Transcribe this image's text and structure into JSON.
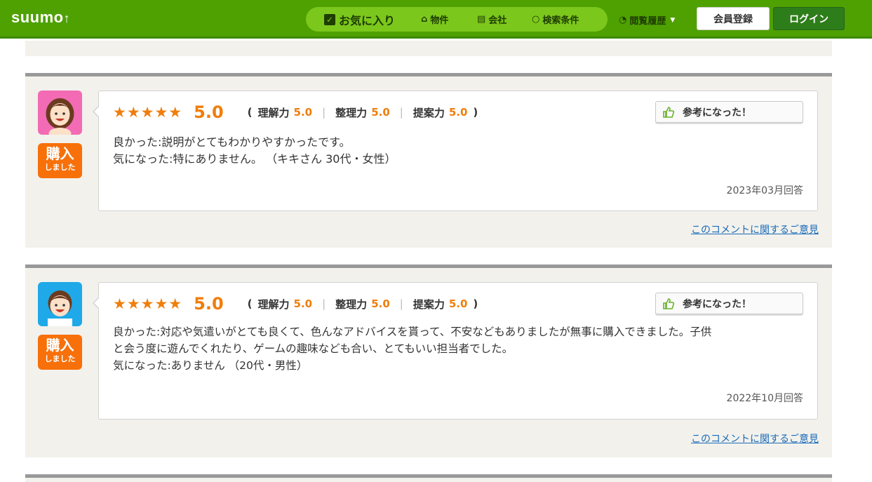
{
  "header": {
    "logo": "suumo",
    "nav": {
      "favorites": "お気に入り",
      "properties": "物件",
      "companies": "会社",
      "search_conditions": "検索条件"
    },
    "history": "閲覧履歴",
    "register": "会員登録",
    "login": "ログイン"
  },
  "colors": {
    "brand_green": "#4ea101",
    "accent_orange": "#f07e0b",
    "link_blue": "#1a6bb8"
  },
  "reviews": [
    {
      "avatar": "female-avatar-icon",
      "badge_top": "購入",
      "badge_bottom": "しました",
      "stars": "★★★★★",
      "score": "5.0",
      "rikai_label": "理解力",
      "rikai": "5.0",
      "seiri_label": "整理力",
      "seiri": "5.0",
      "teian_label": "提案力",
      "teian": "5.0",
      "helpful": "参考になった！",
      "lines": [
        "良かった:説明がとてもわかりやすかったです。",
        "気になった:特にありません。 （キキさん 30代・女性）"
      ],
      "date": "2023年03月回答",
      "opinion": "このコメントに関するご意見"
    },
    {
      "avatar": "male-avatar-icon",
      "badge_top": "購入",
      "badge_bottom": "しました",
      "stars": "★★★★★",
      "score": "5.0",
      "rikai_label": "理解力",
      "rikai": "5.0",
      "seiri_label": "整理力",
      "seiri": "5.0",
      "teian_label": "提案力",
      "teian": "5.0",
      "helpful": "参考になった！",
      "lines": [
        "良かった:対応や気遣いがとても良くて、色んなアドバイスを貰って、不安などもありましたが無事に購入できました。子供",
        "と会う度に遊んでくれたり、ゲームの趣味なども合い、とてもいい担当者でした。",
        "気になった:ありません （20代・男性）"
      ],
      "date": "2022年10月回答",
      "opinion": "このコメントに関するご意見"
    }
  ]
}
